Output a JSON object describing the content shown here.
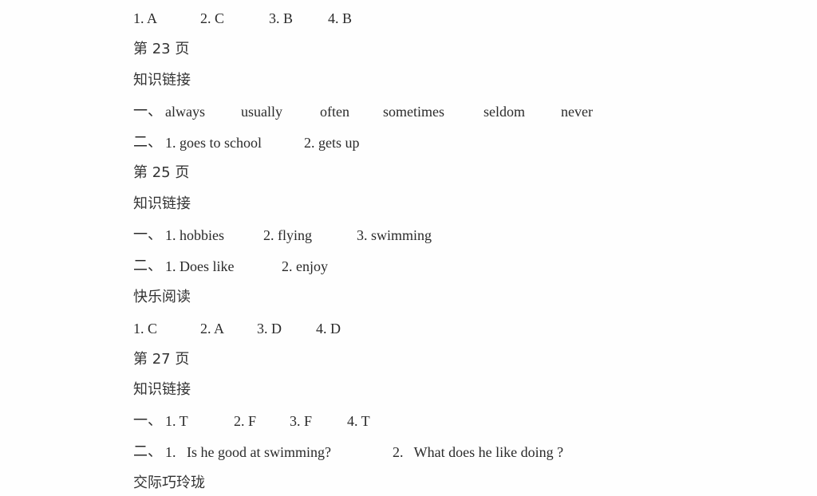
{
  "lines": [
    {
      "type": "answers",
      "items": [
        "1.  A",
        "2.   C",
        "3. B",
        "4. B"
      ]
    },
    {
      "type": "page",
      "text": "第 23 页"
    },
    {
      "type": "section",
      "text": "知识链接"
    },
    {
      "type": "answers",
      "prefix": "一、",
      "items": [
        "always",
        "usually",
        "often",
        "sometimes",
        "seldom",
        "never"
      ]
    },
    {
      "type": "answers",
      "prefix": "二、",
      "items": [
        "1. goes to school",
        "2. gets up"
      ]
    },
    {
      "type": "page",
      "text": "第 25 页"
    },
    {
      "type": "section",
      "text": "知识链接"
    },
    {
      "type": "answers",
      "prefix": "一、",
      "items": [
        "1. hobbies",
        "2. flying",
        "3. swimming"
      ]
    },
    {
      "type": "answers",
      "prefix": "二、",
      "items": [
        "1. Does like",
        "2. enjoy"
      ]
    },
    {
      "type": "section",
      "text": "快乐阅读"
    },
    {
      "type": "answers",
      "items": [
        "1.  C",
        "2. A",
        "3. D",
        "4. D"
      ]
    },
    {
      "type": "page",
      "text": "第 27 页"
    },
    {
      "type": "section",
      "text": "知识链接"
    },
    {
      "type": "answers",
      "prefix": "一、",
      "items": [
        "1.   T",
        "2. F",
        "3. F",
        "4. T"
      ]
    },
    {
      "type": "answers",
      "prefix": "二、",
      "items": [
        "1.   Is he good at swimming?",
        "2.   What does he like doing ?"
      ]
    },
    {
      "type": "section",
      "text": "交际巧玲珑"
    }
  ]
}
